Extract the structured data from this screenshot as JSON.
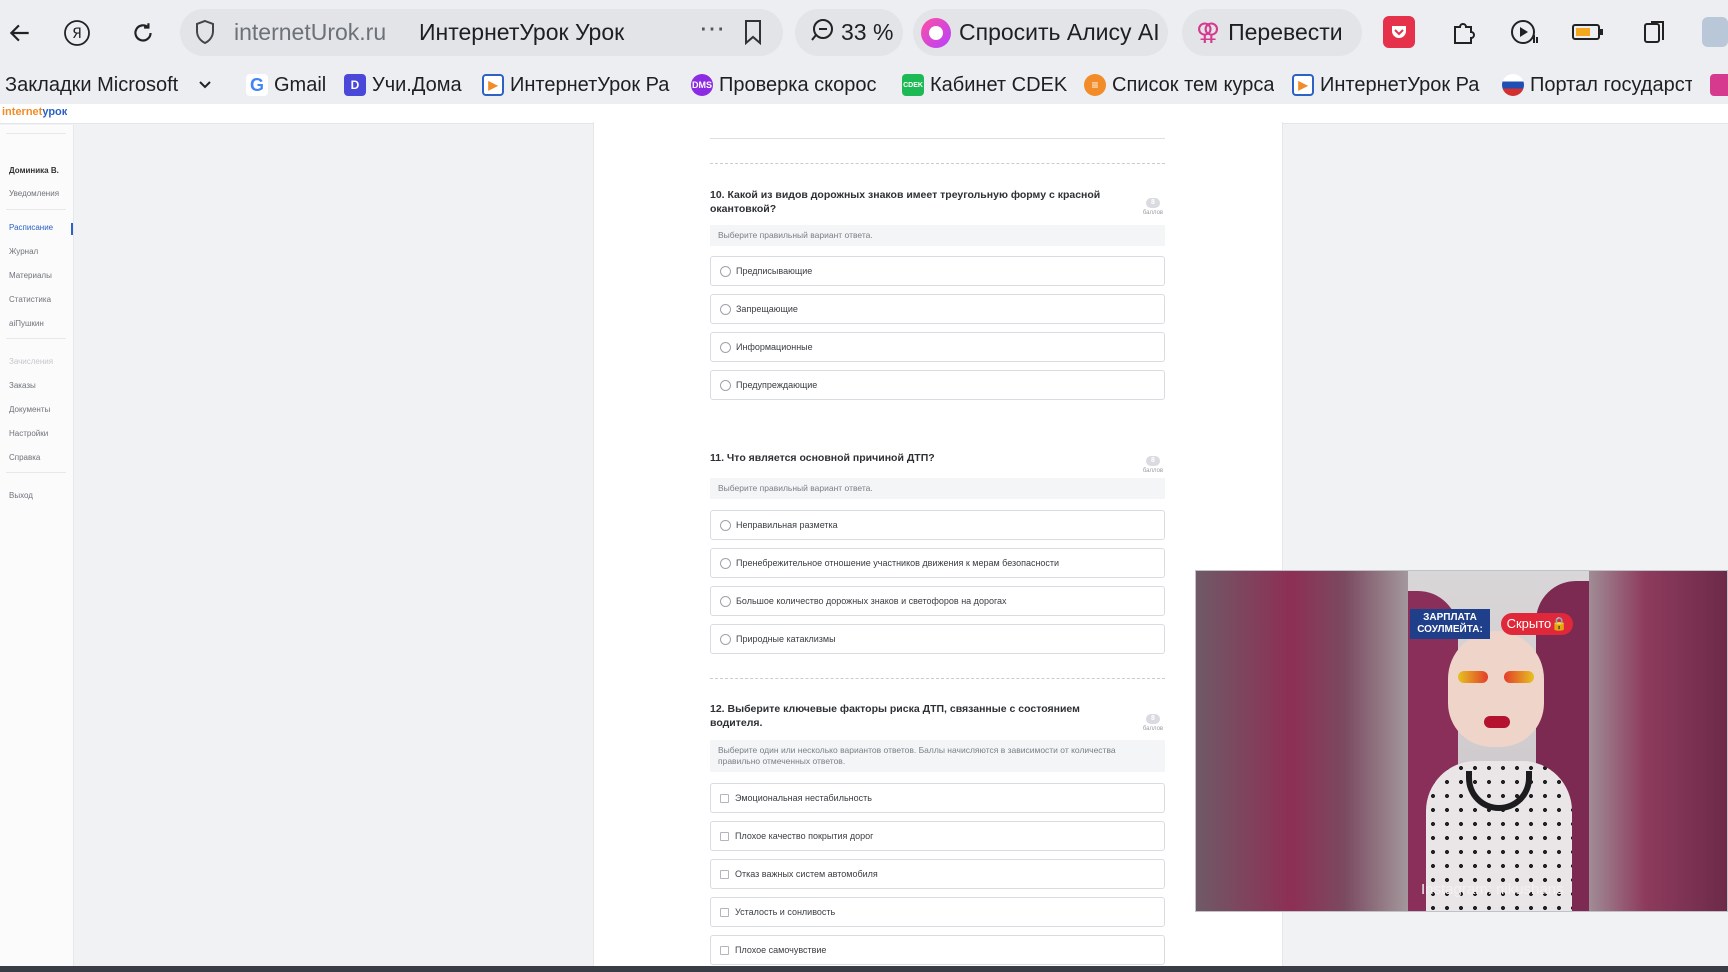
{
  "browser": {
    "host": "internetUrok.ru",
    "page_title": "ИнтернетУрок Урок",
    "zoom": "33 %",
    "alice_label": "Спросить Алису AI",
    "translate_label": "Перевести"
  },
  "bookmarks": [
    {
      "label": "Закладки Microsoft E",
      "color": "#ffffff"
    },
    {
      "label": "Gmail",
      "color": "#ffffff"
    },
    {
      "label": "Учи.Дома",
      "color": "#4a48d8"
    },
    {
      "label": "ИнтернетУрок Ра",
      "color": "#2b62c3"
    },
    {
      "label": "Проверка скорос",
      "color": "#8b2be2"
    },
    {
      "label": "Кабинет CDEK",
      "color": "#1db954"
    },
    {
      "label": "Список тем курса",
      "color": "#f28c28"
    },
    {
      "label": "ИнтернетУрок Ра",
      "color": "#2b62c3"
    },
    {
      "label": "Портал государст",
      "color": "#d32f2f"
    }
  ],
  "site": {
    "logo_a": "internet",
    "logo_b": "урок"
  },
  "sidebar": {
    "user": "Доминика В.",
    "items": [
      "Уведомления",
      "Расписание",
      "Журнал",
      "Материалы",
      "Статистика",
      "aiПушкин",
      "Зачисления",
      "Заказы",
      "Документы",
      "Настройки",
      "Справка",
      "Выход"
    ]
  },
  "questions": [
    {
      "title": "10. Какой из видов дорожных знаков имеет треугольную форму с красной окантовкой?",
      "points": "8",
      "points_label": "баллов",
      "instruction": "Выберите правильный вариант ответа.",
      "options": [
        "Предписывающие",
        "Запрещающие",
        "Информационные",
        "Предупреждающие"
      ]
    },
    {
      "title": "11. Что является основной причиной ДТП?",
      "points": "8",
      "points_label": "баллов",
      "instruction": "Выберите правильный вариант ответа.",
      "options": [
        "Неправильная разметка",
        "Пренебрежительное отношение участников движения к мерам безопасности",
        "Большое количество дорожных знаков и светофоров на дорогах",
        "Природные катаклизмы"
      ]
    },
    {
      "title": "12. Выберите ключевые факторы риска ДТП, связанные с состоянием водителя.",
      "points": "8",
      "points_label": "баллов",
      "instruction": "Выберите один или несколько вариантов ответов. Баллы начисляются в зависимости от количества правильно отмеченных ответов.",
      "options": [
        "Эмоциональная нестабильность",
        "Плохое качество покрытия дорог",
        "Отказ важных систем автомобиля",
        "Усталость и сонливость",
        "Плохое самочувствие"
      ]
    }
  ],
  "video": {
    "caption_top": "ЗАРПЛАТА СОУЛМЕЙТА:",
    "caption_hidden": "Скрыто🔒",
    "watermark": "Instagram: nikushans"
  }
}
